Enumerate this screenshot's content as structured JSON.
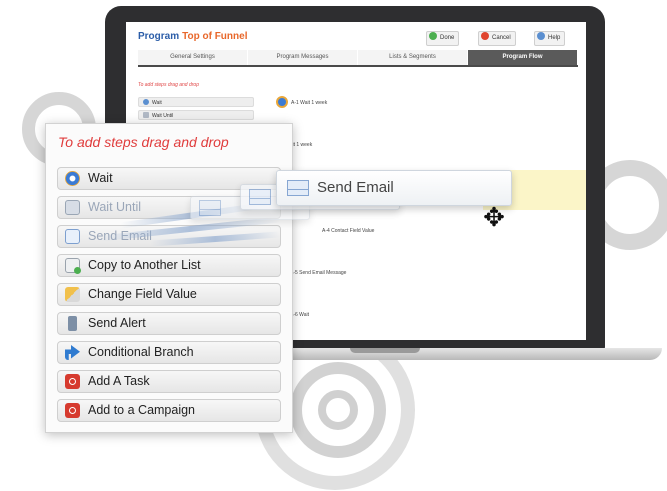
{
  "app": {
    "title_prefix": "Program",
    "title_name": "Top of Funnel",
    "buttons": {
      "done": "Done",
      "cancel": "Cancel",
      "help": "Help"
    },
    "tabs": [
      {
        "label": "General Settings",
        "active": false
      },
      {
        "label": "Program Messages",
        "active": false
      },
      {
        "label": "Lists & Segments",
        "active": false
      },
      {
        "label": "Program Flow",
        "active": true
      }
    ],
    "hint": "To add steps drag and drop",
    "mini_items": [
      "Wait",
      "Wait Until"
    ],
    "steps": [
      "A-1 Wait 1 week",
      "A-2 Wait 1 week",
      "A-4 Contact Field Value",
      "A-5 Send Email Message",
      "A-6 Wait"
    ]
  },
  "palette": {
    "hint": "To add steps drag and drop",
    "items": [
      {
        "label": "Wait",
        "icon": "clock-icon"
      },
      {
        "label": "Wait Until",
        "icon": "calendar-icon"
      },
      {
        "label": "Send Email",
        "icon": "envelope-icon"
      },
      {
        "label": "Copy to Another List",
        "icon": "copy-list-icon"
      },
      {
        "label": "Change Field Value",
        "icon": "pencil-icon"
      },
      {
        "label": "Send Alert",
        "icon": "phone-icon"
      },
      {
        "label": "Conditional Branch",
        "icon": "branch-arrow-icon"
      },
      {
        "label": "Add A Task",
        "icon": "task-icon"
      },
      {
        "label": "Add to a Campaign",
        "icon": "campaign-icon"
      }
    ]
  },
  "drag": {
    "label": "Send Email",
    "ghost_label": "Send Email",
    "cursor": "move-cursor"
  },
  "colors": {
    "title_blue": "#2b5da8",
    "title_orange": "#e8672a",
    "hint_red": "#e03c3c",
    "drop_highlight": "#fbf5c8"
  }
}
